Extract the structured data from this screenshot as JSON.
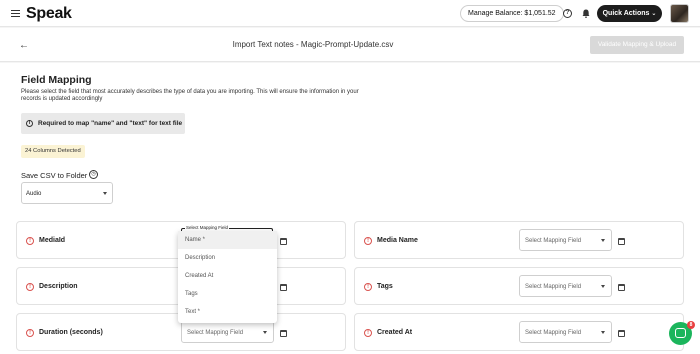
{
  "header": {
    "logo": "Speak",
    "balance": "Manage Balance: $1,051.52",
    "quick_actions": "Quick Actions",
    "help_glyph": "?",
    "avatar_name": "user-avatar"
  },
  "subheader": {
    "back_glyph": "←",
    "title": "Import Text notes - Magic-Prompt-Update.csv",
    "validate_label": "Validate Mapping & Upload"
  },
  "main": {
    "title": "Field Mapping",
    "description": "Please select the field that most accurately describes the type of data you are importing. This will ensure the information in your records is updated accordingly",
    "notice": "Required to map \"name\" and \"text\" for text file",
    "columns_detected": "24 Columns Detected",
    "save_csv_label": "Save CSV to Folder",
    "folder_value": "Audio"
  },
  "fields": [
    {
      "name": "MediaId",
      "select": ""
    },
    {
      "name": "Media Name",
      "select": "Select Mapping Field"
    },
    {
      "name": "Description",
      "select": ""
    },
    {
      "name": "Tags",
      "select": "Select Mapping Field"
    },
    {
      "name": "Duration (seconds)",
      "select": "Select Mapping Field"
    },
    {
      "name": "Created At",
      "select": "Select Mapping Field"
    }
  ],
  "dropdown": {
    "label": "Select Mapping Field",
    "options": [
      "Name *",
      "Description",
      "Created At",
      "Tags",
      "Text *"
    ]
  },
  "chat": {
    "badge": "8"
  },
  "colors": {
    "accent_dark": "#1d1d1d",
    "warning": "#d9534f",
    "chat_green": "#1bb55c",
    "badge_bg": "#fbf3d4"
  }
}
